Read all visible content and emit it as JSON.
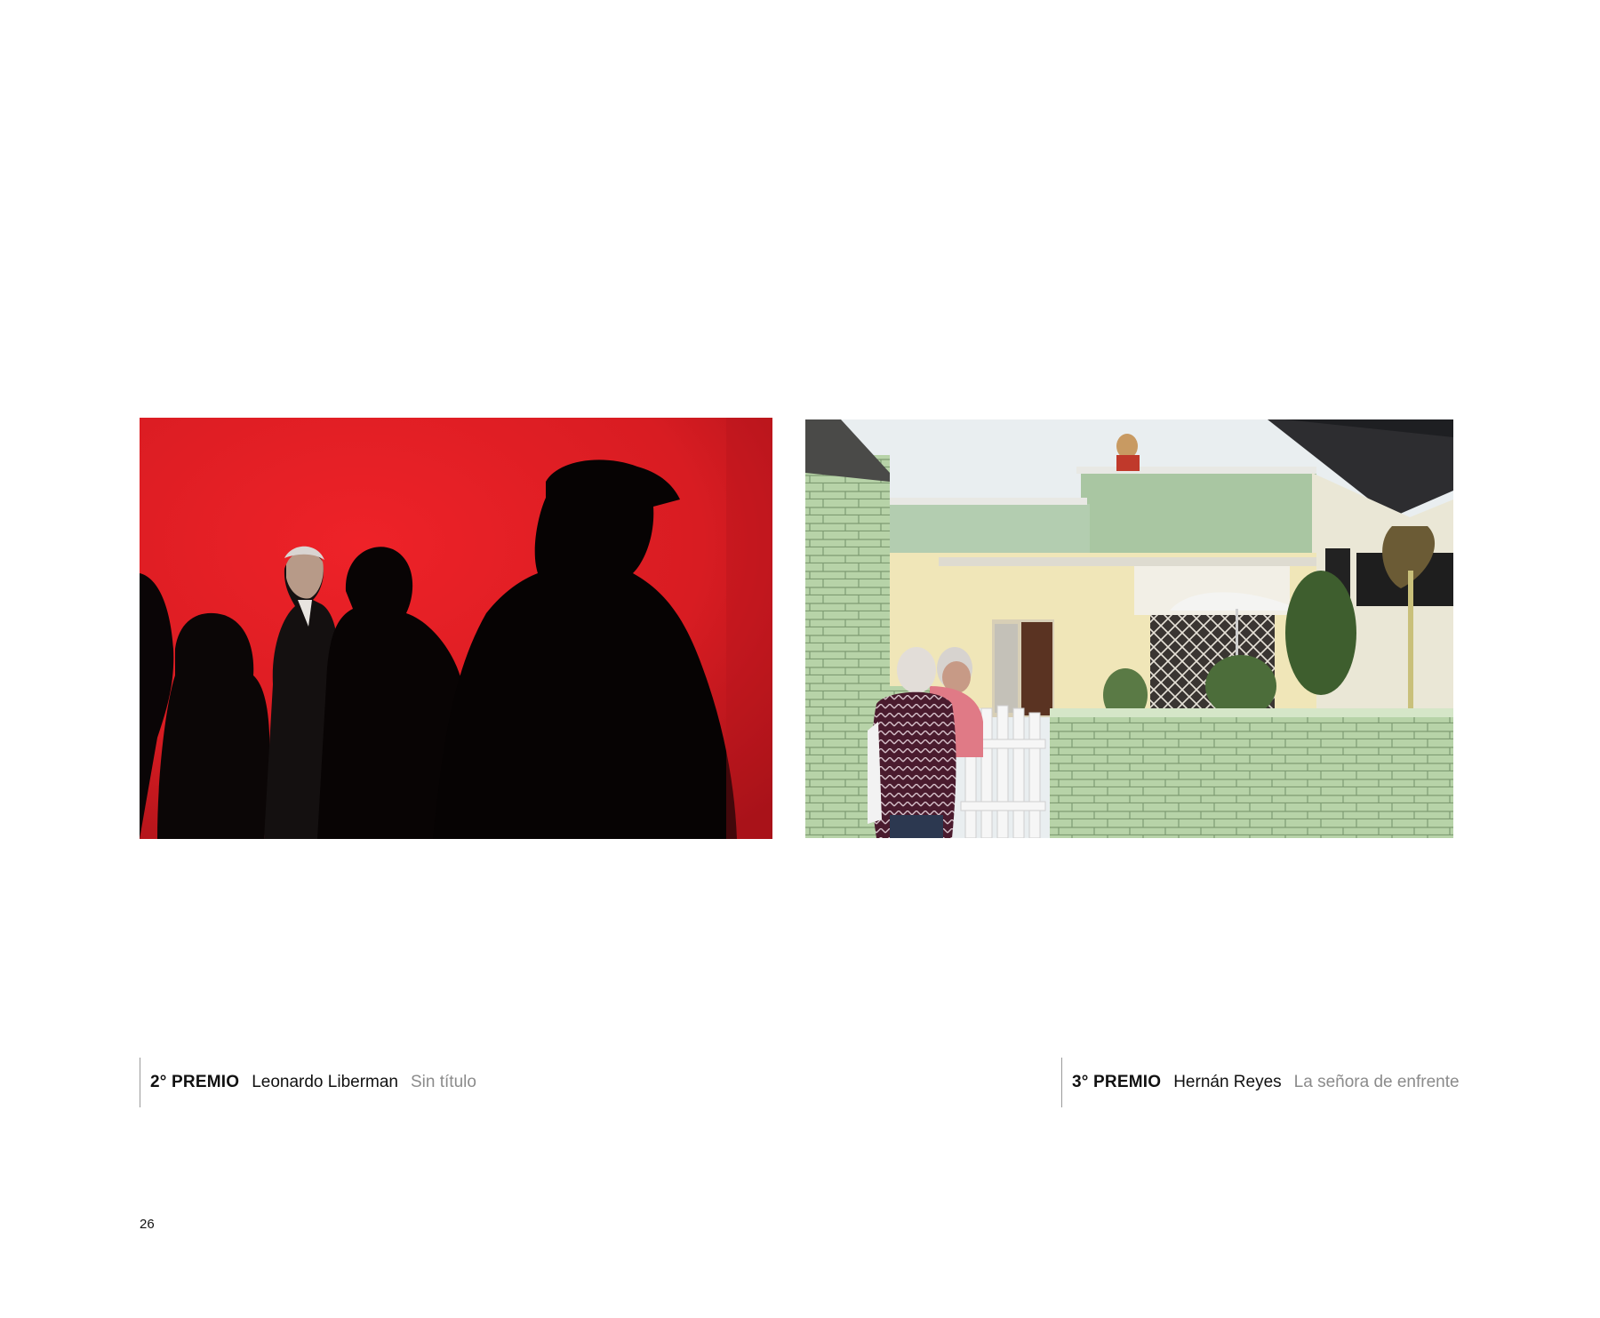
{
  "photos": [
    {
      "prize": "2° PREMIO",
      "author": "Leonardo Liberman",
      "title": "Sin título"
    },
    {
      "prize": "3° PREMIO",
      "author": "Hernán Reyes",
      "title": "La señora de enfrente"
    }
  ],
  "page_number": "26",
  "colors": {
    "accent_red": "#e11a22",
    "wall_green": "#a8c79c",
    "caption_gray": "#8b8b8b"
  }
}
